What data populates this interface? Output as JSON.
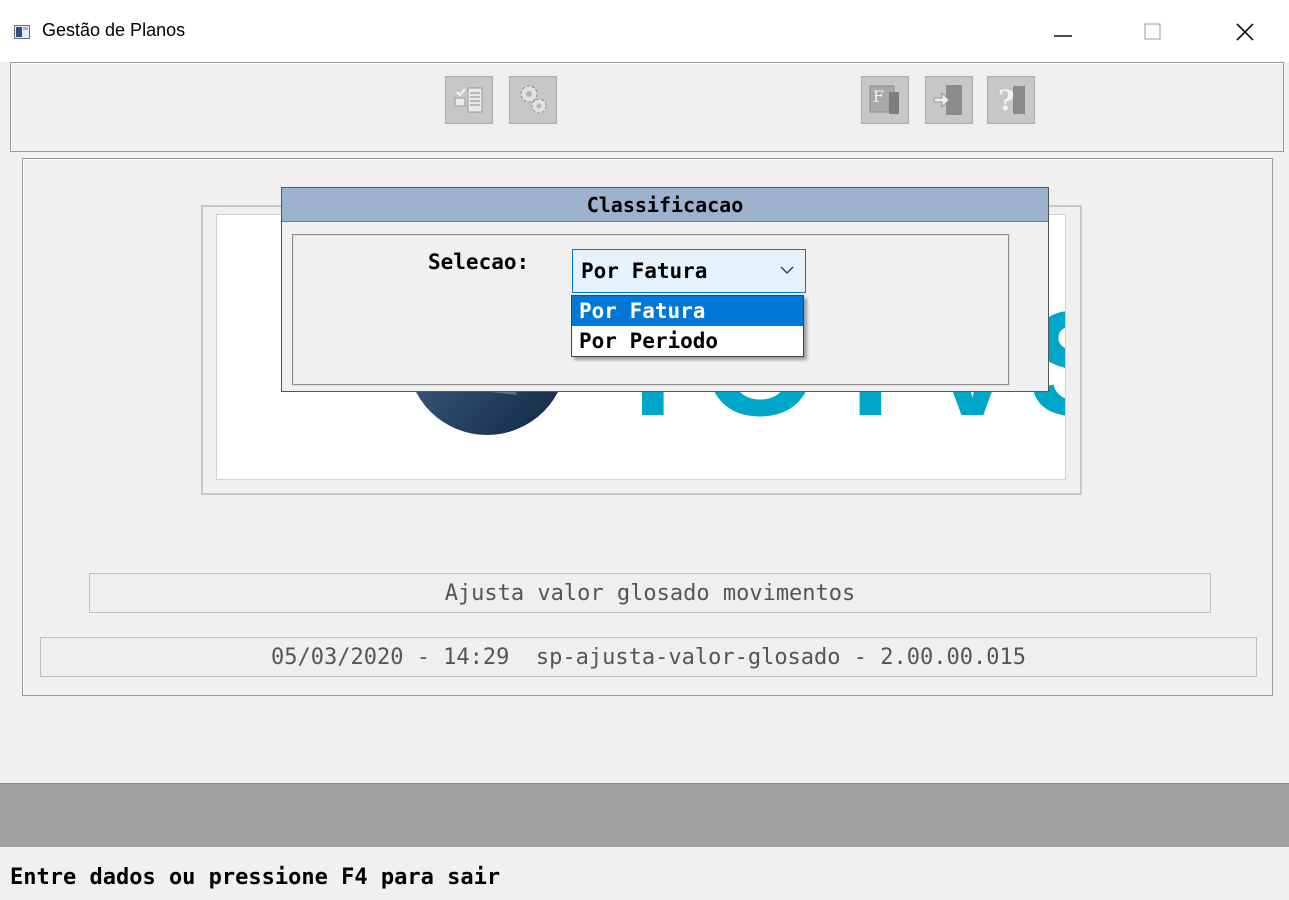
{
  "window": {
    "title": "Gestão de Planos",
    "controls": {
      "minimize": "—",
      "maximize": "☐",
      "close": "✕"
    }
  },
  "toolbar": {
    "buttons": [
      {
        "icon": "checklist-icon"
      },
      {
        "icon": "gears-icon"
      },
      {
        "icon": "f-key-icon"
      },
      {
        "icon": "exit-door-icon"
      },
      {
        "icon": "help-question-icon"
      }
    ]
  },
  "logo": {
    "text": "TOTVS",
    "colors": {
      "sphere": "#1a3a5c",
      "text": "#00a6c7"
    }
  },
  "dialog": {
    "title": "Classificacao",
    "selection_label": "Selecao:",
    "selection_value": "Por Fatura",
    "options": [
      "Por Fatura",
      "Por Periodo"
    ],
    "selected_index": 0
  },
  "program": {
    "description": "Ajusta valor glosado movimentos",
    "info": "05/03/2020 - 14:29  sp-ajusta-valor-glosado - 2.00.00.015"
  },
  "status": {
    "message": "Entre dados ou pressione F4 para sair"
  },
  "colors": {
    "dialog_title_bg": "#9db2cc",
    "selection_highlight": "#0078d7",
    "gray_band": "#a0a0a0"
  }
}
